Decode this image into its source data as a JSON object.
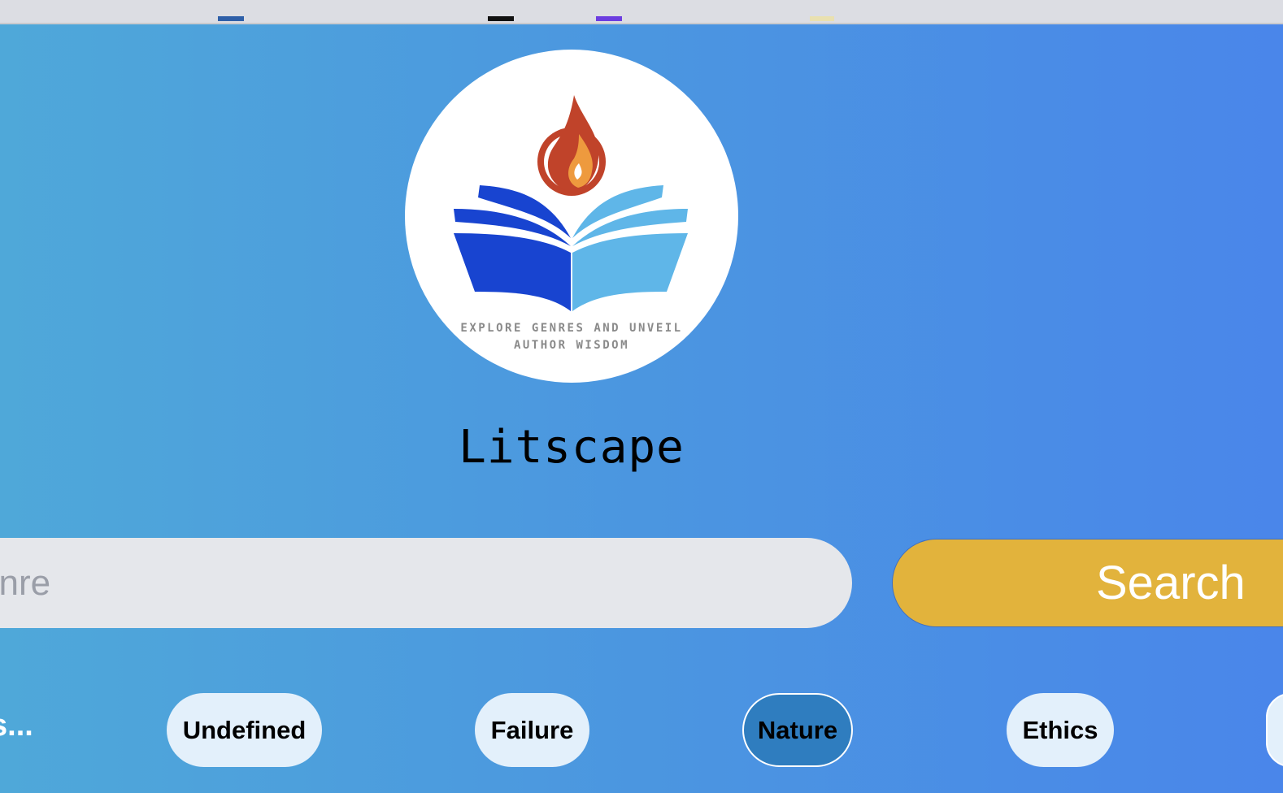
{
  "app": {
    "title": "Litscape",
    "logo_tagline_line1": "EXPLORE GENRES AND UNVEIL",
    "logo_tagline_line2": "AUTHOR WISDOM"
  },
  "search": {
    "placeholder_visible": "enre",
    "button_label": "Search"
  },
  "tags": {
    "truncated_label": "s...",
    "items": [
      {
        "label": "Undefined",
        "active": false
      },
      {
        "label": "Failure",
        "active": false
      },
      {
        "label": "Nature",
        "active": true
      },
      {
        "label": "Ethics",
        "active": false
      }
    ]
  },
  "colors": {
    "background_start": "#4fa8d9",
    "background_end": "#4a86ea",
    "search_button": "#e2b33c",
    "input_background": "#e5e7eb",
    "chip_background": "#e3f0fb",
    "chip_active": "#2f7dbf",
    "logo_flame_outer": "#c0432a",
    "logo_flame_inner": "#ee9a3e",
    "logo_book_left": "#1844d0",
    "logo_book_right": "#5fb6e8"
  },
  "icons": [
    "book-flame-logo-icon"
  ]
}
